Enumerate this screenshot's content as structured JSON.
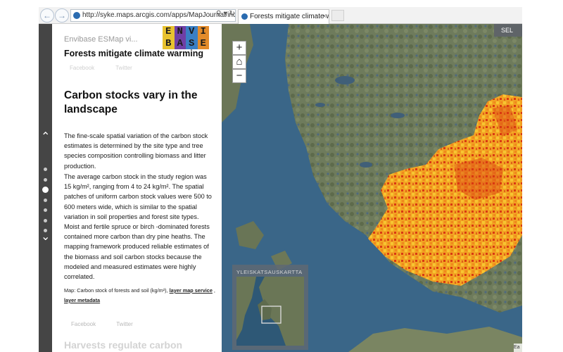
{
  "browser": {
    "url": "http://syke.maps.arcgis.com/apps/MapJournal/ind",
    "tab_title": "Forests mitigate climate wa...",
    "tab_close": "×"
  },
  "panel": {
    "brand": "Envibase ESMap vi...",
    "logo_letters": [
      "E",
      "N",
      "V",
      "I",
      "B",
      "A",
      "S",
      "E"
    ],
    "journal_title": "Forests mitigate climate warming",
    "share_items": [
      "Facebook",
      "Twitter"
    ],
    "section_title": "Carbon stocks vary in the landscape",
    "paragraphs": [
      "The fine-scale spatial variation of the carbon stock estimates is determined by the site type and tree species composition controlling biomass and litter production.",
      "The average carbon stock in the study region was 15 kg/m², ranging from 4 to 24 kg/m². The spatial patches of uniform carbon stock values were 500 to 600 meters wide, which is similar to the spatial variation in soil properties and forest site types. Moist and fertile spruce or birch -dominated forests contained more carbon than dry pine heaths. The mapping framework produced reliable estimates of the biomass and soil carbon stocks because the modeled and measured estimates were highly correlated."
    ],
    "caption_text": "Map: Carbon stock of forests and soil (kg/m²), ",
    "caption_link_service": "layer map service",
    "caption_separator": " , ",
    "caption_link_metadata": "layer metadata",
    "social_items": [
      "Facebook",
      "Twitter"
    ],
    "next_section_title": "Harvests regulate carbon"
  },
  "nav": {
    "up_icon": "chevron-up-icon",
    "down_icon": "chevron-down-icon",
    "dot_count": 7,
    "active_dot": 2
  },
  "map": {
    "zoom_in": "+",
    "home_icon": "home-icon",
    "zoom_out": "−",
    "top_button": "SEL",
    "overview_title": "YLEISKATSAUSKARTTA",
    "attribution": "Ea",
    "colors": {
      "sea": "#3a6688",
      "land": "#6f7a5e",
      "carbon_high": "#d93a12",
      "carbon_mid": "#f08a1c",
      "carbon_low": "#f7c531"
    }
  }
}
